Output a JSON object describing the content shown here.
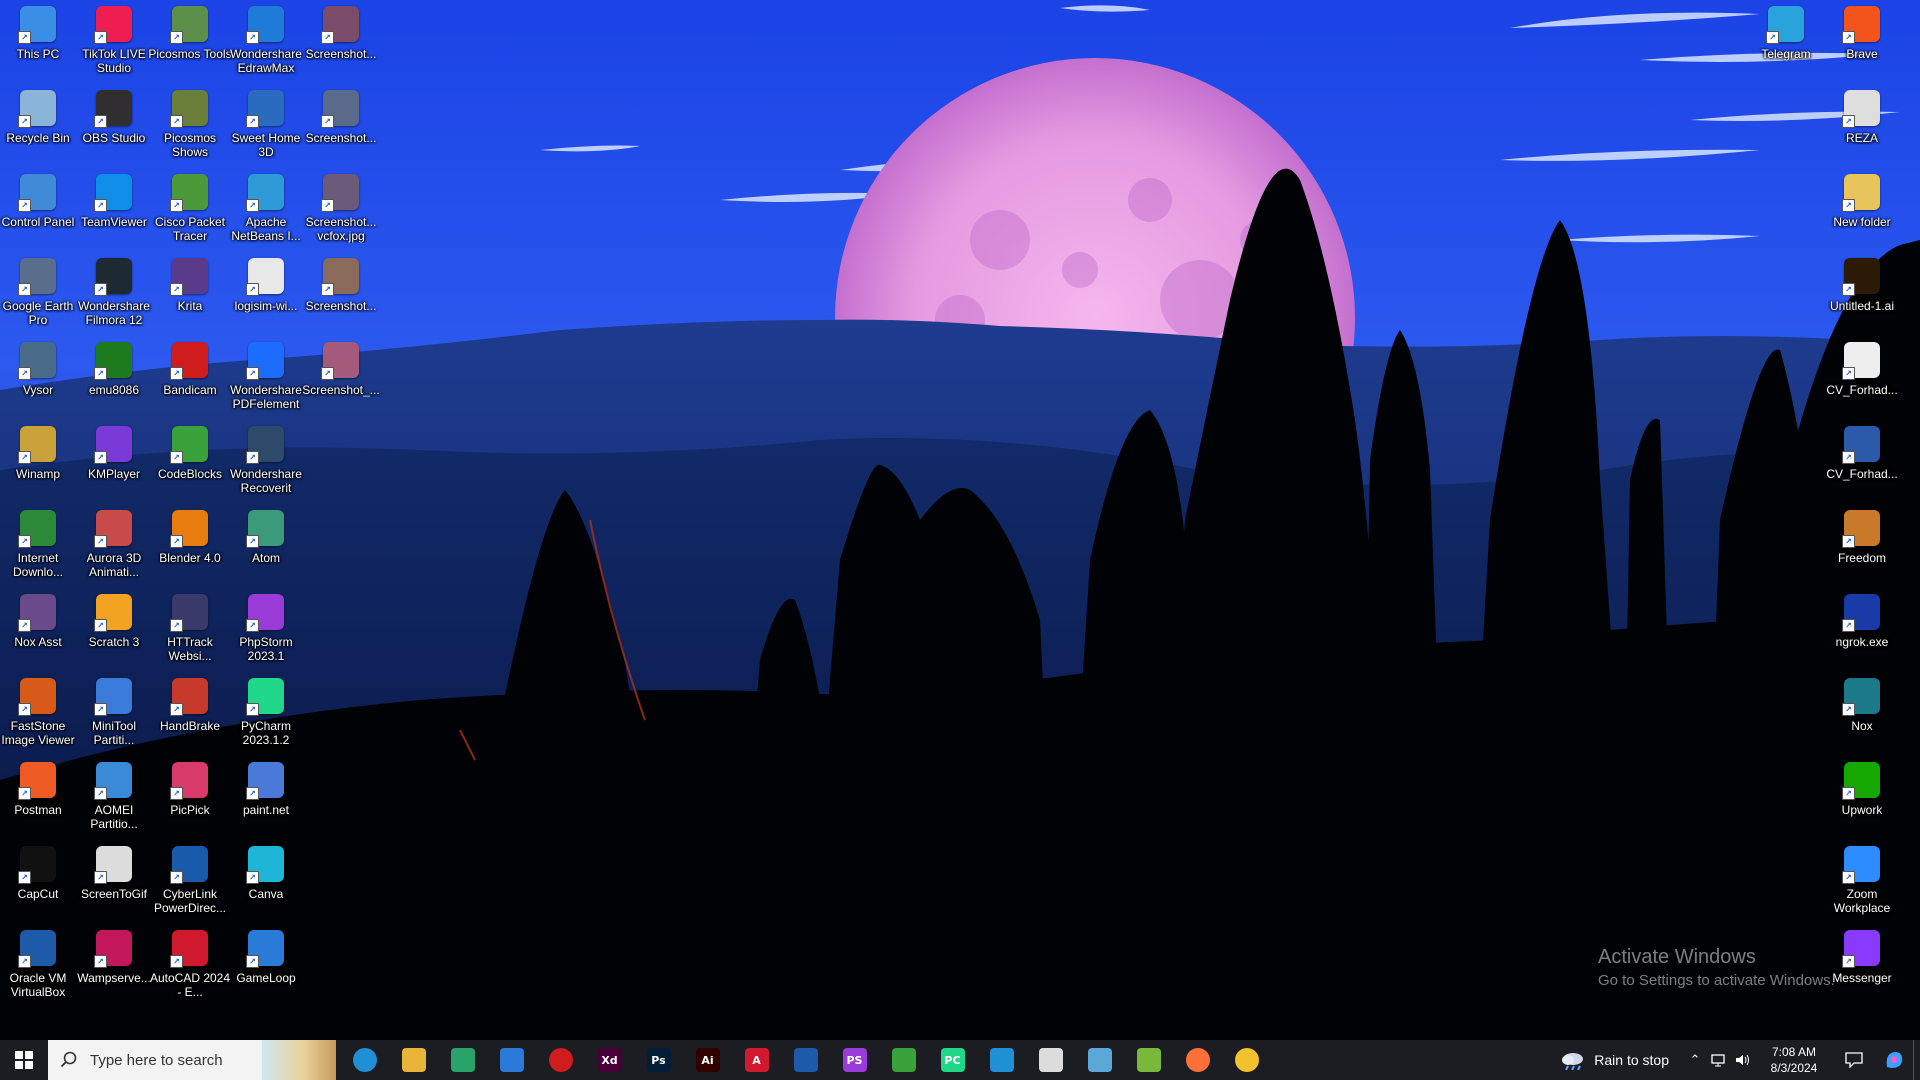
{
  "desktop": {
    "left_icons": [
      {
        "label": "This PC",
        "icon": "computer-icon",
        "color": "#3a8ee6"
      },
      {
        "label": "TikTok LIVE Studio",
        "icon": "tiktok-live-icon",
        "color": "#ee1d52"
      },
      {
        "label": "Picosmos Tools",
        "icon": "picosmos-tools-icon",
        "color": "#5b8f4a"
      },
      {
        "label": "Wondershare EdrawMax",
        "icon": "edrawmax-icon",
        "color": "#1f7bd8"
      },
      {
        "label": "Screenshot...",
        "icon": "image-file-icon",
        "color": "#7b4b6a"
      },
      {
        "label": "Recycle Bin",
        "icon": "recycle-bin-icon",
        "color": "#8ab4d8"
      },
      {
        "label": "OBS Studio",
        "icon": "obs-icon",
        "color": "#302e31"
      },
      {
        "label": "Picosmos Shows",
        "icon": "picosmos-shows-icon",
        "color": "#6a7f3a"
      },
      {
        "label": "Sweet Home 3D",
        "icon": "sweet-home-icon",
        "color": "#2a6bbf"
      },
      {
        "label": "Screenshot...",
        "icon": "image-file-icon",
        "color": "#5a6a8a"
      },
      {
        "label": "Control Panel",
        "icon": "control-panel-icon",
        "color": "#3f8bd8"
      },
      {
        "label": "TeamViewer",
        "icon": "teamviewer-icon",
        "color": "#0e8ee9"
      },
      {
        "label": "Cisco Packet Tracer",
        "icon": "cisco-icon",
        "color": "#4a9a3a"
      },
      {
        "label": "Apache NetBeans I...",
        "icon": "netbeans-icon",
        "color": "#2f9bd6"
      },
      {
        "label": "Screenshot... vcfox.jpg",
        "icon": "image-file-icon",
        "color": "#6b5a7a"
      },
      {
        "label": "Google Earth Pro",
        "icon": "google-earth-icon",
        "color": "#5a6d8a"
      },
      {
        "label": "Wondershare Filmora 12",
        "icon": "filmora-icon",
        "color": "#1d2a33"
      },
      {
        "label": "Krita",
        "icon": "krita-icon",
        "color": "#5a3a8a"
      },
      {
        "label": "logisim-wi...",
        "icon": "logisim-icon",
        "color": "#e8e8e8"
      },
      {
        "label": "Screenshot...",
        "icon": "image-file-icon",
        "color": "#8a6a5a"
      },
      {
        "label": "Vysor",
        "icon": "vysor-icon",
        "color": "#4a6a8a"
      },
      {
        "label": "emu8086",
        "icon": "emu8086-icon",
        "color": "#1d7a1d"
      },
      {
        "label": "Bandicam",
        "icon": "bandicam-icon",
        "color": "#d01c1c"
      },
      {
        "label": "Wondershare PDFelement",
        "icon": "pdfelement-icon",
        "color": "#1b6cff"
      },
      {
        "label": "Screenshot_...",
        "icon": "image-file-icon",
        "color": "#a45a7a"
      },
      {
        "label": "Winamp",
        "icon": "winamp-icon",
        "color": "#c9a23a"
      },
      {
        "label": "KMPlayer",
        "icon": "kmplayer-icon",
        "color": "#7a3ad8"
      },
      {
        "label": "CodeBlocks",
        "icon": "codeblocks-icon",
        "color": "#3aa23a"
      },
      {
        "label": "Wondershare Recoverit",
        "icon": "recoverit-icon",
        "color": "#2d4a6a"
      },
      {
        "label": "Internet Downlo...",
        "icon": "idm-icon",
        "color": "#2a8a3a"
      },
      {
        "label": "Aurora 3D Animati...",
        "icon": "aurora-3d-icon",
        "color": "#c94a4a"
      },
      {
        "label": "Blender 4.0",
        "icon": "blender-icon",
        "color": "#e87d0d"
      },
      {
        "label": "Atom",
        "icon": "atom-icon",
        "color": "#3a9a7a"
      },
      {
        "label": "Nox Asst",
        "icon": "nox-asst-icon",
        "color": "#6a4a8a"
      },
      {
        "label": "Scratch 3",
        "icon": "scratch-icon",
        "color": "#f2a322"
      },
      {
        "label": "HTTrack Websi...",
        "icon": "httrack-icon",
        "color": "#3a3a6a"
      },
      {
        "label": "PhpStorm 2023.1",
        "icon": "phpstorm-icon",
        "color": "#9a3ad8"
      },
      {
        "label": "FastStone Image Viewer",
        "icon": "faststone-icon",
        "color": "#d85a1a"
      },
      {
        "label": "MiniTool Partiti...",
        "icon": "minitool-icon",
        "color": "#3a7ad8"
      },
      {
        "label": "HandBrake",
        "icon": "handbrake-icon",
        "color": "#c73a2a"
      },
      {
        "label": "PyCharm 2023.1.2",
        "icon": "pycharm-icon",
        "color": "#21d789"
      },
      {
        "label": "Postman",
        "icon": "postman-icon",
        "color": "#ef5b25"
      },
      {
        "label": "AOMEI Partitio...",
        "icon": "aomei-icon",
        "color": "#3a8ad8"
      },
      {
        "label": "PicPick",
        "icon": "picpick-icon",
        "color": "#d83a6a"
      },
      {
        "label": "paint.net",
        "icon": "paint-net-icon",
        "color": "#4a7ad8"
      },
      {
        "label": "CapCut",
        "icon": "capcut-icon",
        "color": "#111111"
      },
      {
        "label": "ScreenToGif",
        "icon": "screentogif-icon",
        "color": "#dcdcdc"
      },
      {
        "label": "CyberLink PowerDirec...",
        "icon": "powerdirector-icon",
        "color": "#1a5aaa"
      },
      {
        "label": "Canva",
        "icon": "canva-icon",
        "color": "#1fb5d6"
      },
      {
        "label": "Oracle VM VirtualBox",
        "icon": "virtualbox-icon",
        "color": "#1d5aa8"
      },
      {
        "label": "Wampserve...",
        "icon": "wampserver-icon",
        "color": "#c2185b"
      },
      {
        "label": "AutoCAD 2024 - E...",
        "icon": "autocad-icon",
        "color": "#d0192e"
      },
      {
        "label": "GameLoop",
        "icon": "gameloop-icon",
        "color": "#2a7ad8"
      }
    ],
    "right_icons": [
      {
        "label": "Telegram",
        "icon": "telegram-icon",
        "color": "#2aa3dc"
      },
      {
        "label": "Brave",
        "icon": "brave-icon",
        "color": "#f2541b"
      },
      {
        "label": "REZA",
        "icon": "document-icon",
        "color": "#dedede"
      },
      {
        "label": "New folder",
        "icon": "folder-icon",
        "color": "#e8c55a"
      },
      {
        "label": "Untitled-1.ai",
        "icon": "illustrator-file-icon",
        "color": "#2b1a06"
      },
      {
        "label": "CV_Forhad...",
        "icon": "pdf-file-icon",
        "color": "#eeeeee"
      },
      {
        "label": "CV_Forhad...",
        "icon": "word-file-icon",
        "color": "#2b5aab"
      },
      {
        "label": "Freedom",
        "icon": "freedom-icon",
        "color": "#c87a2a"
      },
      {
        "label": "ngrok.exe",
        "icon": "ngrok-icon",
        "color": "#1a3aa8"
      },
      {
        "label": "Nox",
        "icon": "nox-icon",
        "color": "#1a7a8a"
      },
      {
        "label": "Upwork",
        "icon": "upwork-icon",
        "color": "#14a800"
      },
      {
        "label": "Zoom Workplace",
        "icon": "zoom-icon",
        "color": "#2d8cff"
      },
      {
        "label": "Messenger",
        "icon": "messenger-icon",
        "color": "#8a3aff"
      }
    ],
    "watermark": {
      "title": "Activate Windows",
      "subtitle": "Go to Settings to activate Windows."
    }
  },
  "taskbar": {
    "search_placeholder": "Type here to search",
    "apps": [
      {
        "icon": "edge-icon",
        "label": "",
        "color": "#1f8fd6"
      },
      {
        "icon": "file-explorer-icon",
        "label": "",
        "color": "#e8b53a"
      },
      {
        "icon": "edge-beta-icon",
        "label": "",
        "color": "#2aa36a"
      },
      {
        "icon": "store-icon",
        "label": "",
        "color": "#2a7ad8"
      },
      {
        "icon": "record-icon",
        "label": "",
        "color": "#d01c1c"
      },
      {
        "icon": "adobe-xd-icon",
        "label": "Xd",
        "color": "#470137"
      },
      {
        "icon": "photoshop-icon",
        "label": "Ps",
        "color": "#001e36"
      },
      {
        "icon": "illustrator-icon",
        "label": "Ai",
        "color": "#330000"
      },
      {
        "icon": "autocad-icon",
        "label": "A",
        "color": "#d0192e"
      },
      {
        "icon": "virtualbox-icon",
        "label": "",
        "color": "#1d5aa8"
      },
      {
        "icon": "phpstorm-icon",
        "label": "PS",
        "color": "#9a3ad8"
      },
      {
        "icon": "codeblocks-icon",
        "label": "",
        "color": "#3aa23a"
      },
      {
        "icon": "pycharm-icon",
        "label": "PC",
        "color": "#21d789"
      },
      {
        "icon": "vscode-icon",
        "label": "",
        "color": "#1f8fd6"
      },
      {
        "icon": "app-store-icon",
        "label": "",
        "color": "#dcdcdc"
      },
      {
        "icon": "notepad-icon",
        "label": "",
        "color": "#5aa8d8"
      },
      {
        "icon": "notepad-plus-icon",
        "label": "",
        "color": "#7ab83a"
      },
      {
        "icon": "firefox-icon",
        "label": "",
        "color": "#ff7139"
      },
      {
        "icon": "chrome-icon",
        "label": "",
        "color": "#f2c12e"
      }
    ],
    "weather_text": "Rain to stop",
    "time": "7:08 AM",
    "date": "8/3/2024"
  }
}
